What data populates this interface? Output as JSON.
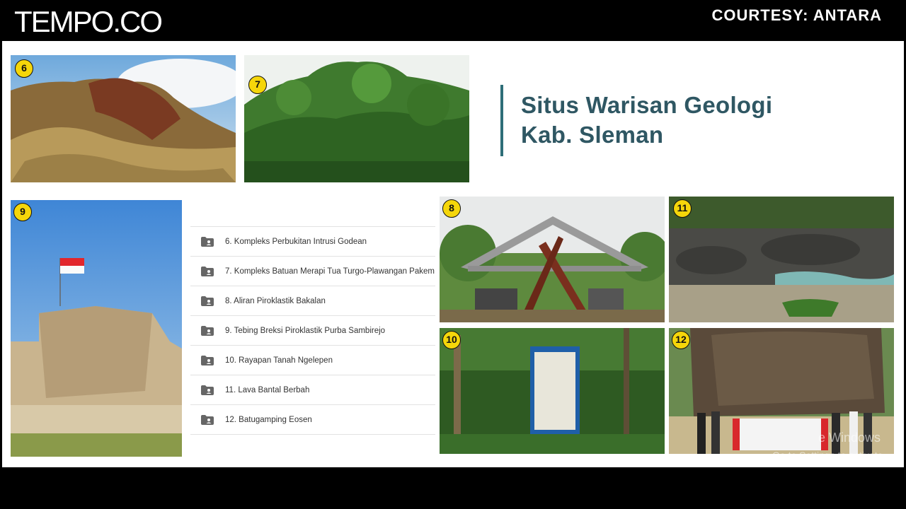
{
  "header": {
    "logo": "TEMPO.CO",
    "courtesy": "COURTESY: ANTARA"
  },
  "slide": {
    "title_line1": "Situs Warisan Geologi",
    "title_line2": "Kab. Sleman",
    "list_items": [
      "6. Kompleks Perbukitan Intrusi Godean",
      "7. Kompleks Batuan Merapi Tua Turgo-Plawangan Pakem",
      "8. Aliran Piroklastik Bakalan",
      "9. Tebing Breksi Piroklastik Purba Sambirejo",
      "10. Rayapan Tanah Ngelepen",
      "11. Lava Bantal Berbah",
      "12. Batugamping Eosen"
    ],
    "photos": [
      {
        "badge": "6"
      },
      {
        "badge": "7"
      },
      {
        "badge": "9"
      },
      {
        "badge": "8"
      },
      {
        "badge": "11"
      },
      {
        "badge": "10"
      },
      {
        "badge": "12"
      }
    ]
  },
  "watermark": {
    "line1": "e Windows",
    "line2": "Go to Settings to activate"
  },
  "icons": {
    "list_item_icon": "folder-user-icon",
    "photo_icons": [
      "rock-outcrop-photo",
      "forest-hill-photo",
      "breccia-cliff-photo",
      "monument-gate-photo",
      "river-lava-photo",
      "signboard-photo",
      "group-photo"
    ]
  },
  "colors": {
    "title": "#2f5763",
    "title_bar": "#2e6e78",
    "badge": "#f5d60a"
  }
}
